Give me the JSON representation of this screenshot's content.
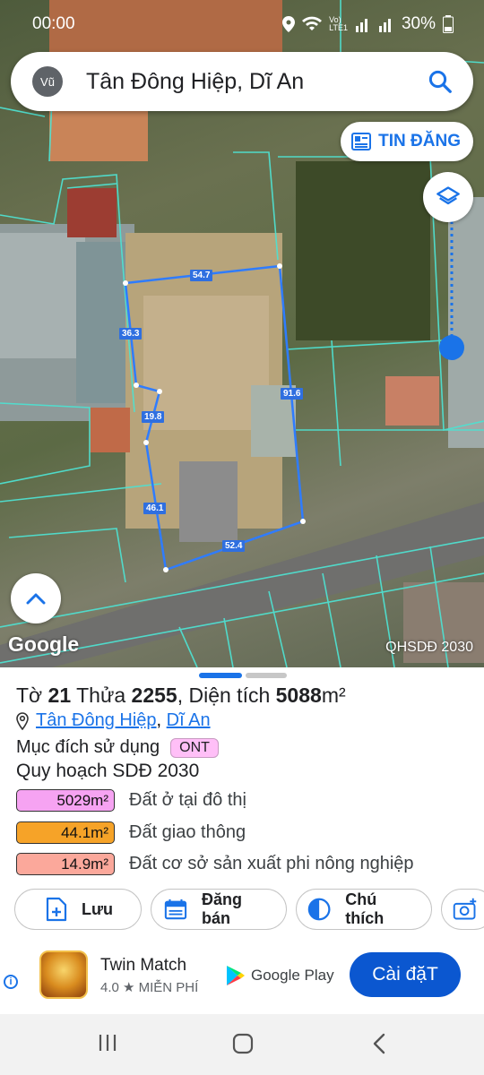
{
  "status": {
    "time": "00:00",
    "battery": "30%"
  },
  "search": {
    "avatar": "Vũ",
    "query": "Tân Đông Hiệp, Dĩ An"
  },
  "map": {
    "tin_dang_label": "TIN ĐĂNG",
    "google_logo": "Google",
    "layer_label": "QHSDĐ 2030",
    "edge_lengths": [
      "54.7",
      "36.3",
      "91.6",
      "19.8",
      "46.1",
      "52.4"
    ]
  },
  "parcel": {
    "title_prefix": "Tờ",
    "sheet_no": "21",
    "parcel_prefix": "Thửa",
    "parcel_no": "2255",
    "area_prefix": ", Diện tích",
    "area": "5088",
    "area_unit": "m²",
    "ward": "Tân Đông Hiệp",
    "district": "Dĩ An",
    "purpose_label": "Mục đích sử dụng",
    "purpose_code": "ONT",
    "plan_title": "Quy hoạch SDĐ 2030",
    "plan_rows": [
      {
        "area": "5029m²",
        "label": "Đất ở tại đô thị",
        "color": "#f6a3f2"
      },
      {
        "area": "44.1m²",
        "label": "Đất giao thông",
        "color": "#f6a328"
      },
      {
        "area": "14.9m²",
        "label": "Đất cơ sở sản xuất phi nông nghiệp",
        "color": "#fba89b"
      }
    ]
  },
  "actions": {
    "save": "Lưu",
    "sell": "Đăng bán",
    "legend": "Chú thích"
  },
  "ad": {
    "name": "Twin Match",
    "rating": "4.0 ★  MIỄN PHÍ",
    "store": "Google Play",
    "install": "Cài đặT"
  }
}
